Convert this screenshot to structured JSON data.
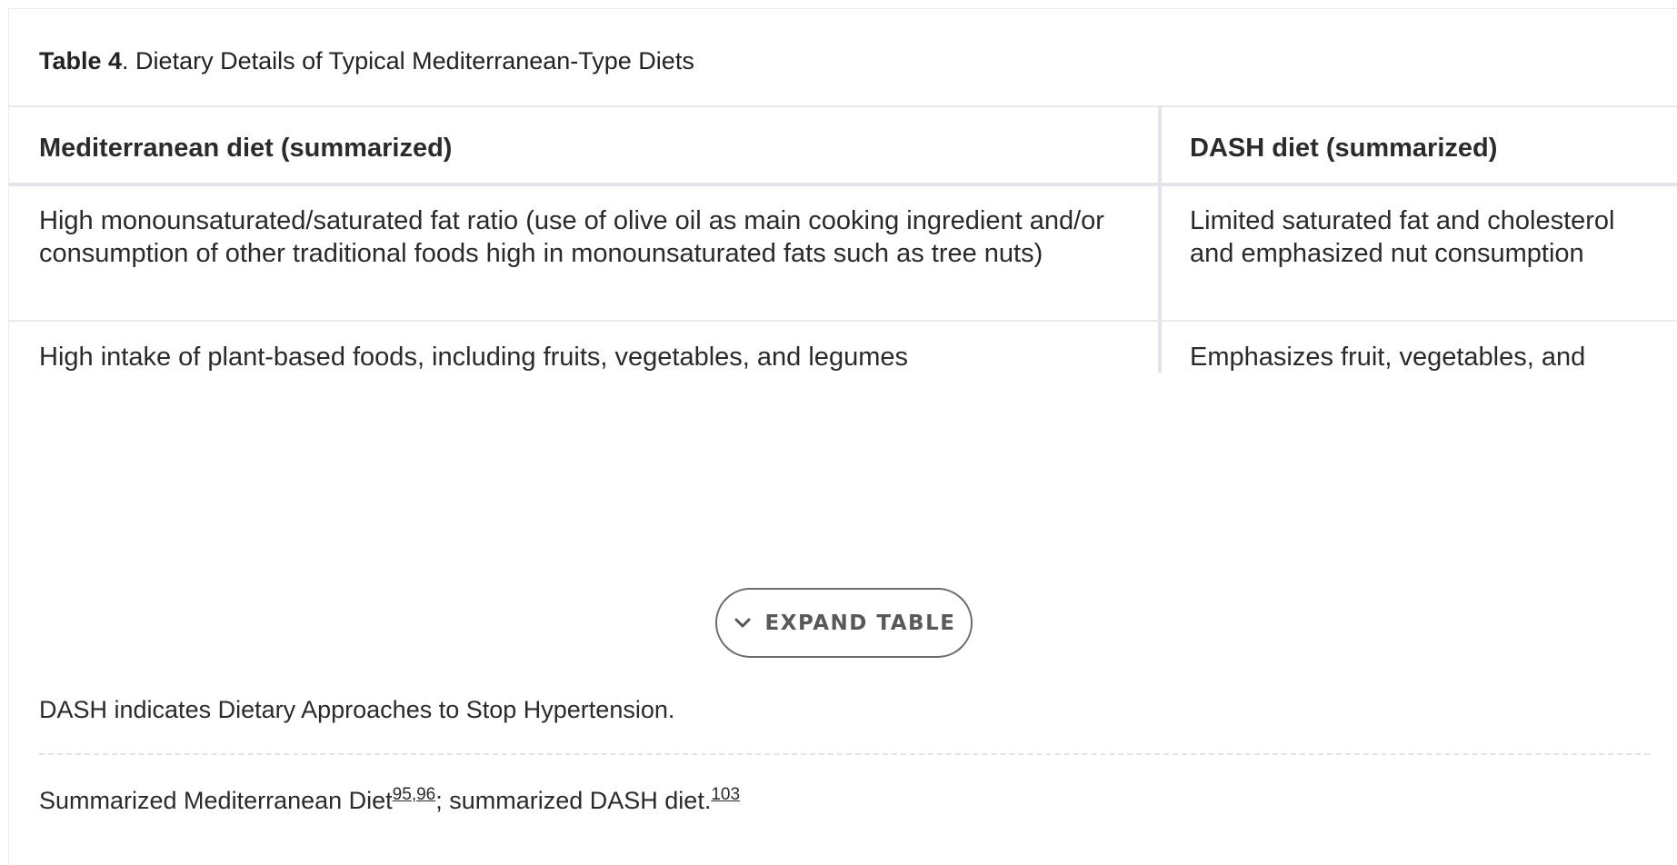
{
  "caption": {
    "label": "Table 4",
    "text": ". Dietary Details of Typical Mediterranean-Type Diets"
  },
  "table": {
    "headers": [
      "Mediterranean diet (summarized)",
      "DASH diet (summarized)"
    ],
    "rows": [
      [
        "High monounsaturated/saturated fat ratio (use of olive oil as main cooking ingredient and/or consumption of other traditional foods high in monounsaturated fats such as tree nuts)",
        "Limited saturated fat and cholesterol and emphasized nut consumption"
      ],
      [
        "High intake of plant-based foods, including fruits, vegetables, and legumes",
        "Emphasizes fruit, vegetables, and"
      ]
    ]
  },
  "expand_button": {
    "label": "EXPAND TABLE",
    "icon": "chevron-down-icon"
  },
  "footnotes": {
    "abbreviation": "DASH indicates Dietary Approaches to Stop Hypertension.",
    "source_prefix": "Summarized Mediterranean Diet",
    "ref_1": "95",
    "ref_sep": ",",
    "ref_2": "96",
    "source_middle": "; summarized DASH diet.",
    "ref_3": "103"
  }
}
